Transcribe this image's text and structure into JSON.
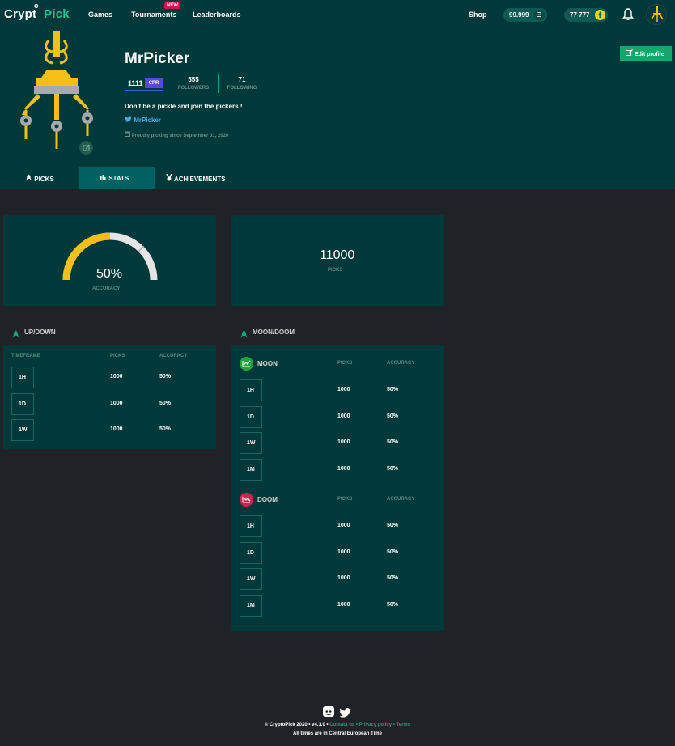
{
  "brand": {
    "name_part1": "Crypt",
    "name_o": "o",
    "name_part2": "Pick"
  },
  "nav": {
    "games": "Games",
    "tournaments": "Tournaments",
    "tournaments_badge": "NEW",
    "leaderboards": "Leaderboards",
    "shop": "Shop",
    "balance_eth": "99.999",
    "balance_eth_icon": "Ξ",
    "balance_coin": "77 777",
    "balance_coin_icon": "●"
  },
  "profile": {
    "username": "MrPicker",
    "score": "1111",
    "score_tag": "CPR",
    "followers_count": "555",
    "followers_label": "FOLLOWERS",
    "following_count": "71",
    "following_label": "FOLLOWING",
    "bio": "Don't be a pickle and join the pickers !",
    "twitter_handle": "MrPicker",
    "since": "Proudly picking since September 01, 2020",
    "edit_button": "Edit profile"
  },
  "tabs": [
    {
      "label": "PICKS",
      "active": false
    },
    {
      "label": "STATS",
      "active": true
    },
    {
      "label": "ACHIEVEMENTS",
      "active": false
    }
  ],
  "accuracy": {
    "value": "50%",
    "fraction": 0.5,
    "label": "ACCURACY"
  },
  "picks": {
    "value": "11000",
    "label": "PICKS"
  },
  "updown": {
    "title": "UP/DOWN",
    "col_timeframe": "TIMEFRAME",
    "col_picks": "PICKS",
    "col_accuracy": "ACCURACY",
    "rows": [
      {
        "tf": "1H",
        "picks": "1000",
        "accuracy": "50%"
      },
      {
        "tf": "1D",
        "picks": "1000",
        "accuracy": "50%"
      },
      {
        "tf": "1W",
        "picks": "1000",
        "accuracy": "50%"
      }
    ]
  },
  "moondoom": {
    "title": "MOON/DOOM",
    "moon": {
      "label": "MOON",
      "col_picks": "PICKS",
      "col_accuracy": "ACCURACY",
      "rows": [
        {
          "tf": "1H",
          "picks": "1000",
          "accuracy": "50%"
        },
        {
          "tf": "1D",
          "picks": "1000",
          "accuracy": "50%"
        },
        {
          "tf": "1W",
          "picks": "1000",
          "accuracy": "50%"
        },
        {
          "tf": "1M",
          "picks": "1000",
          "accuracy": "50%"
        }
      ]
    },
    "doom": {
      "label": "DOOM",
      "col_picks": "PICKS",
      "col_accuracy": "ACCURACY",
      "rows": [
        {
          "tf": "1H",
          "picks": "1000",
          "accuracy": "50%"
        },
        {
          "tf": "1D",
          "picks": "1000",
          "accuracy": "50%"
        },
        {
          "tf": "1W",
          "picks": "1000",
          "accuracy": "50%"
        },
        {
          "tf": "1M",
          "picks": "1000",
          "accuracy": "50%"
        }
      ]
    }
  },
  "footer": {
    "copyright": "© CryptoPick 2020 • v4.1.0 •",
    "contact": "Contact us",
    "sep1": "•",
    "privacy": "Privacy policy",
    "sep2": "•",
    "terms": "Terms",
    "timezone": "All times are in Central European Time"
  },
  "colors": {
    "accent": "#18a56c",
    "panel": "#00393a",
    "background": "#1f2227",
    "gauge_fill": "#f4c016",
    "moon": "#1fa53e",
    "doom": "#c8284f"
  }
}
